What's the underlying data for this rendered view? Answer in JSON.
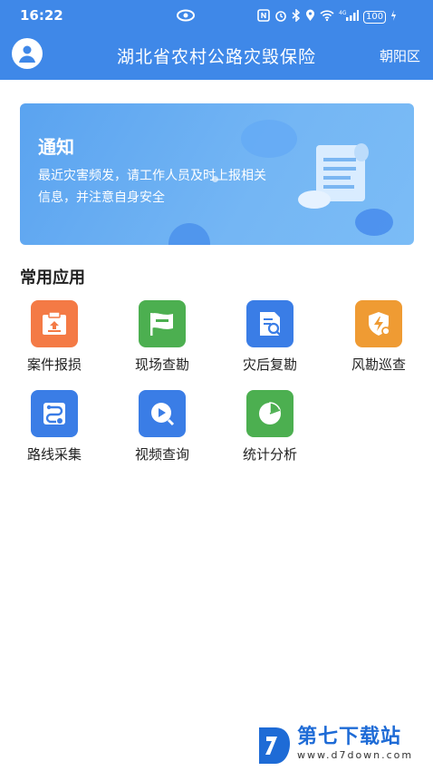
{
  "status_bar": {
    "time": "16:22",
    "battery": "100"
  },
  "header": {
    "title": "湖北省农村公路灾毁保险",
    "district": "朝阳区"
  },
  "notice": {
    "title": "通知",
    "text": "最近灾害频发，请工作人员及时上报相关信息，并注意自身安全"
  },
  "apps": {
    "section_title": "常用应用",
    "items": [
      {
        "label": "案件报损",
        "icon": "case-report-icon",
        "color": "#f47a45"
      },
      {
        "label": "现场查勘",
        "icon": "flag-icon",
        "color": "#4caf50"
      },
      {
        "label": "灾后复勘",
        "icon": "document-search-icon",
        "color": "#3a7de6"
      },
      {
        "label": "风勘巡查",
        "icon": "shield-lightning-icon",
        "color": "#ef9b33"
      },
      {
        "label": "路线采集",
        "icon": "route-icon",
        "color": "#3a7de6"
      },
      {
        "label": "视频查询",
        "icon": "video-search-icon",
        "color": "#3a7de6"
      },
      {
        "label": "统计分析",
        "icon": "pie-chart-icon",
        "color": "#4caf50"
      }
    ]
  },
  "watermark": {
    "title": "第七下载站",
    "url": "www.d7down.com"
  }
}
